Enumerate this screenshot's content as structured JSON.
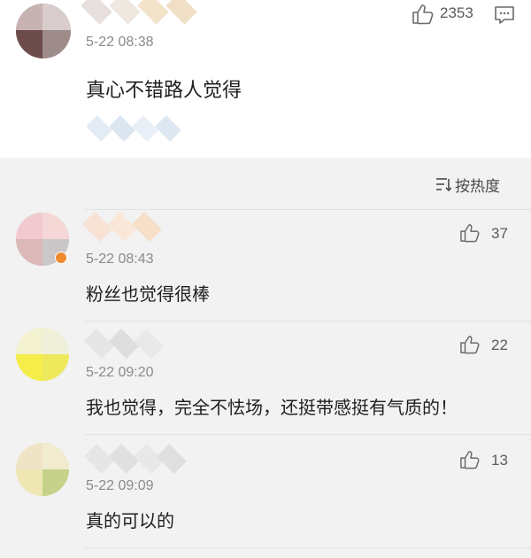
{
  "main_comment": {
    "time": "5-22 08:38",
    "text": "真心不错路人觉得",
    "like_count": "2353",
    "like_icon": "thumbs-up-icon",
    "reply_icon": "comment-icon"
  },
  "sort": {
    "label": "按热度",
    "icon": "sort-lines-icon"
  },
  "replies": [
    {
      "time": "5-22 08:43",
      "text": "粉丝也觉得很棒",
      "like_count": "37"
    },
    {
      "time": "5-22 09:20",
      "text": "我也觉得，完全不怯场，还挺带感挺有气质的！",
      "like_count": "22"
    },
    {
      "time": "5-22 09:09",
      "text": "真的可以的",
      "like_count": "13"
    }
  ],
  "colors": {
    "background_top": "#ffffff",
    "background_replies": "#f2f2f2",
    "text_primary": "#1f1f1f",
    "text_secondary": "#8a8a8a"
  }
}
